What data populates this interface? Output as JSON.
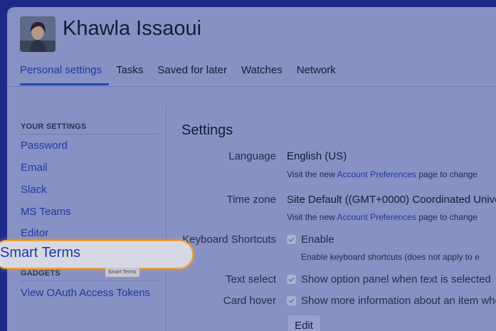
{
  "profile": {
    "name": "Khawla Issaoui",
    "avatar_icon": "user-avatar-icon"
  },
  "tabs": [
    {
      "label": "Personal settings",
      "active": true
    },
    {
      "label": "Tasks",
      "active": false
    },
    {
      "label": "Saved for later",
      "active": false
    },
    {
      "label": "Watches",
      "active": false
    },
    {
      "label": "Network",
      "active": false
    }
  ],
  "sidebar": {
    "your_settings_heading": "YOUR SETTINGS",
    "items": [
      {
        "label": "Password"
      },
      {
        "label": "Email"
      },
      {
        "label": "Slack"
      },
      {
        "label": "MS Teams"
      },
      {
        "label": "Editor"
      }
    ],
    "highlighted_item": "Smart Terms",
    "gadgets_heading": "GADGETS",
    "tooltip": "Smart Terms",
    "oauth_link": "View OAuth Access Tokens"
  },
  "settings": {
    "title": "Settings",
    "language": {
      "label": "Language",
      "value": "English (US)",
      "hint_prefix": "Visit the new ",
      "hint_link": "Account Preferences",
      "hint_suffix": " page to change"
    },
    "timezone": {
      "label": "Time zone",
      "value": "Site Default ((GMT+0000) Coordinated Unive",
      "hint_prefix": "Visit the new ",
      "hint_link": "Account Preferences",
      "hint_suffix": " page to change"
    },
    "keyboard_shortcuts": {
      "label": "Keyboard Shortcuts",
      "checkbox_label": "Enable",
      "checked": true,
      "hint": "Enable keyboard shortcuts (does not apply to e"
    },
    "text_select": {
      "label": "Text select",
      "checkbox_label": "Show option panel when text is selected",
      "checked": true
    },
    "card_hover": {
      "label": "Card hover",
      "checkbox_label": "Show more information about an item whe",
      "checked": true
    },
    "edit_button": "Edit"
  },
  "colors": {
    "backdrop": "#1d2a8a",
    "overlay_page": "#8791c4",
    "highlight_border": "#f0a236",
    "link": "#1d3a9e"
  }
}
